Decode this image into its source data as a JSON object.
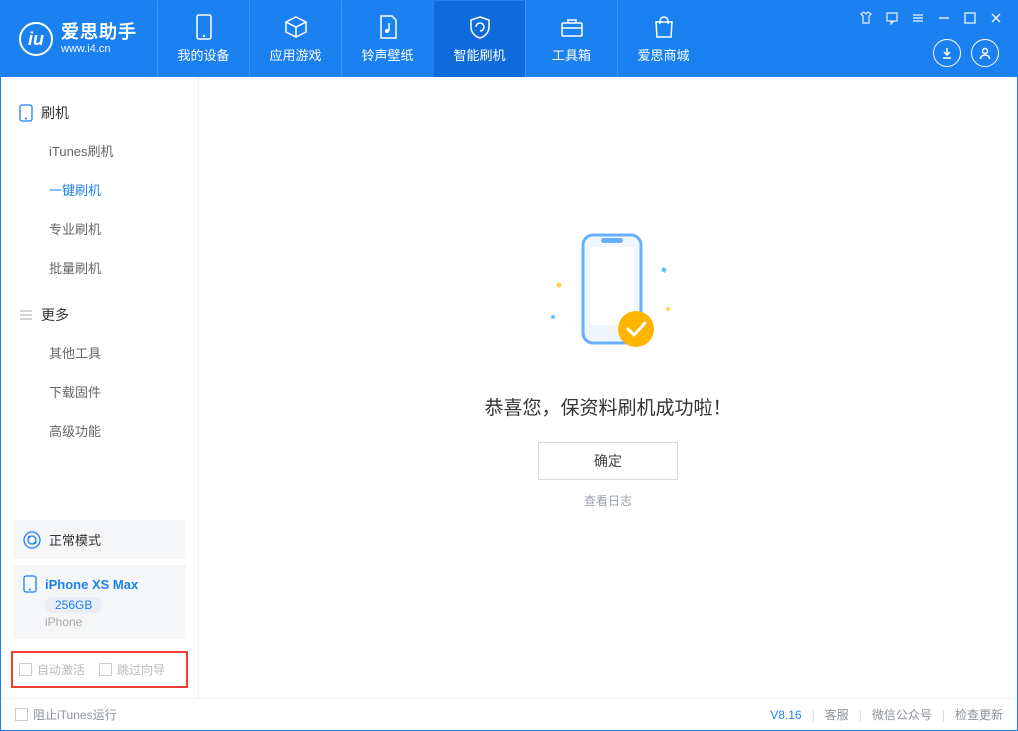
{
  "app": {
    "name": "爱思助手",
    "url": "www.i4.cn"
  },
  "nav": [
    {
      "label": "我的设备"
    },
    {
      "label": "应用游戏"
    },
    {
      "label": "铃声壁纸"
    },
    {
      "label": "智能刷机",
      "active": true
    },
    {
      "label": "工具箱"
    },
    {
      "label": "爱思商城"
    }
  ],
  "sidebar": {
    "section1": {
      "title": "刷机",
      "items": [
        "iTunes刷机",
        "一键刷机",
        "专业刷机",
        "批量刷机"
      ],
      "activeIndex": 1
    },
    "section2": {
      "title": "更多",
      "items": [
        "其他工具",
        "下载固件",
        "高级功能"
      ]
    },
    "status": "正常模式",
    "device": {
      "name": "iPhone XS Max",
      "capacity": "256GB",
      "type": "iPhone"
    },
    "checks": {
      "auto_activate": "自动激活",
      "skip_guide": "跳过向导"
    }
  },
  "main": {
    "success_title": "恭喜您，保资料刷机成功啦！",
    "ok_btn": "确定",
    "view_log": "查看日志"
  },
  "footer": {
    "block_itunes": "阻止iTunes运行",
    "version": "V8.16",
    "links": [
      "客服",
      "微信公众号",
      "检查更新"
    ]
  }
}
